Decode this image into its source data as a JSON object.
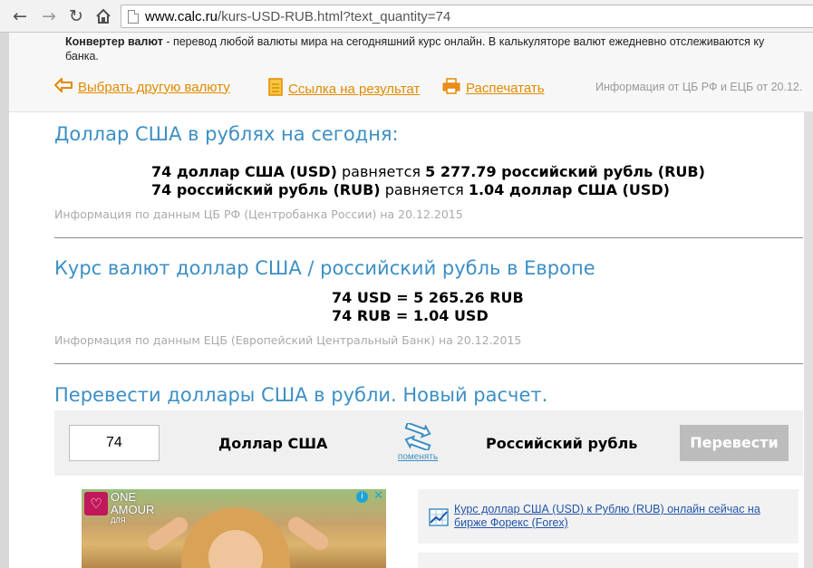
{
  "browser": {
    "url_host": "www.calc.ru",
    "url_rest": "/kurs-USD-RUB.html?text_quantity=74"
  },
  "header": {
    "desc_bold": "Конвертер валют",
    "desc_text": " - перевод любой валюты мира на сегодняшний курс онлайн. В калькуляторе валют ежедневно отслеживаются ку",
    "desc_text2": "банка.",
    "link_choose": "Выбрать другую валюту",
    "link_result": "Ссылка на результат",
    "link_print": "Распечатать",
    "info": "Информация от ЦБ РФ и ЕЦБ от 20.12."
  },
  "cb": {
    "title": "Доллар США в рублях на сегодня:",
    "line1_a": "74 доллар США (USD)",
    "line1_mid": " равняется ",
    "line1_b": "5 277.79 российский рубль (RUB)",
    "line2_a": "74 российский рубль (RUB)",
    "line2_mid": " равняется ",
    "line2_b": "1.04 доллар США (USD)",
    "source": "Информация по данным ЦБ РФ (Центробанка России) на 20.12.2015"
  },
  "ecb": {
    "title": "Курс валют доллар США / российский рубль в Европе",
    "line1": "74 USD = 5 265.26 RUB",
    "line2": "74 RUB = 1.04 USD",
    "source": "Информация по данным ЕЦБ (Европейский Центральный Банк) на 20.12.2015"
  },
  "converter": {
    "title": "Перевести доллары США в рубли. Новый расчет.",
    "quantity": "74",
    "from": "Доллар США",
    "swap_label": "поменять",
    "to": "Российский рубль",
    "button": "Перевести"
  },
  "ad": {
    "brand_line1": "ONE",
    "brand_line2": "AMOUR",
    "sub": "ДЛЯ"
  },
  "forex": {
    "link": "Курс доллар США (USD) к Рублю (RUB) онлайн сейчас на бирже Форекс (Forex)"
  },
  "colors": {
    "accent_blue": "#3d8fc4",
    "link_orange": "#e28a00",
    "button_grey": "#bcbcbc"
  }
}
